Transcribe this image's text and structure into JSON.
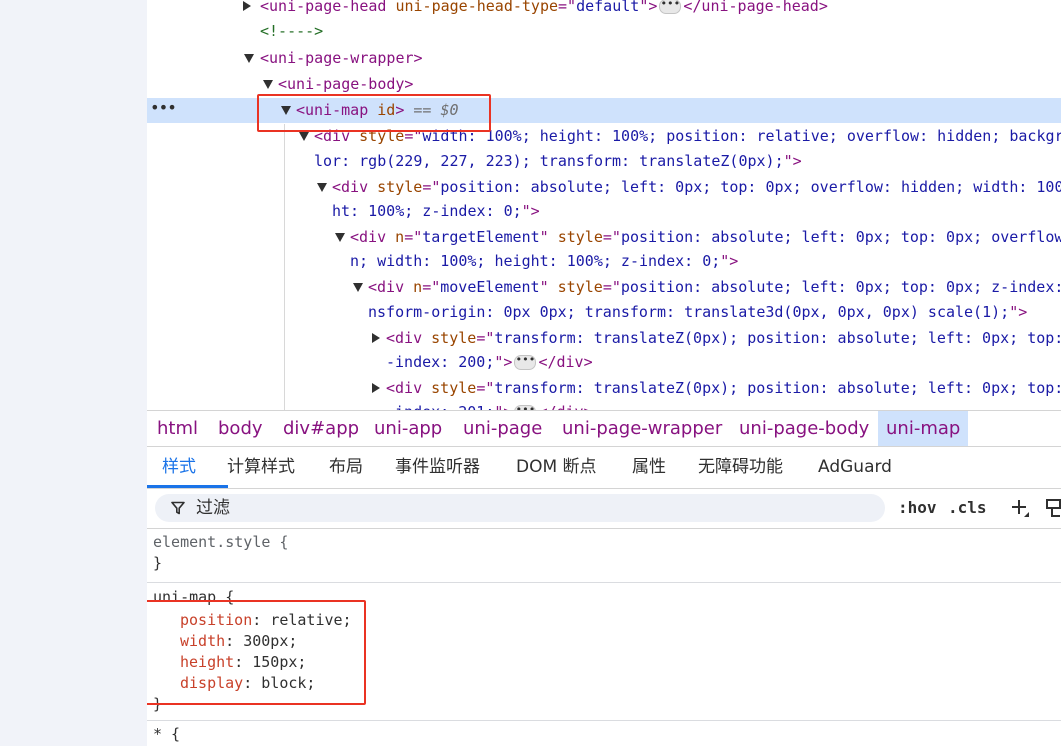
{
  "dom_tree": {
    "lines": [
      {
        "id": "head",
        "parts": [
          [
            "tag",
            "<uni-page-head "
          ],
          [
            "attr",
            "uni-page-head-type"
          ],
          [
            "tag",
            "=\""
          ],
          [
            "val",
            "default"
          ],
          [
            "tag",
            "\">"
          ],
          [
            "pill",
            ""
          ],
          [
            "tag",
            "</uni-page-head>"
          ]
        ]
      },
      {
        "id": "comment",
        "parts": [
          [
            "cmt",
            "<!---->"
          ]
        ]
      },
      {
        "id": "wrapper",
        "parts": [
          [
            "tag",
            "<uni-page-wrapper>"
          ]
        ]
      },
      {
        "id": "body",
        "parts": [
          [
            "tag",
            "<uni-page-body>"
          ]
        ]
      },
      {
        "id": "map",
        "parts": [
          [
            "tag",
            "<uni-map "
          ],
          [
            "attr",
            "id"
          ],
          [
            "tag",
            ">"
          ],
          [
            "hint",
            " == $0"
          ]
        ]
      },
      {
        "id": "div1a",
        "parts": [
          [
            "tag",
            "<div "
          ],
          [
            "attr",
            "style"
          ],
          [
            "tag",
            "=\""
          ],
          [
            "val",
            "width: 100%; height: 100%; position: relative; overflow: hidden; backgr"
          ]
        ]
      },
      {
        "id": "div1b",
        "parts": [
          [
            "val",
            "lor: rgb(229, 227, 223); transform: translateZ(0px);"
          ],
          [
            "tag",
            "\">"
          ]
        ]
      },
      {
        "id": "div2a",
        "parts": [
          [
            "tag",
            "<div "
          ],
          [
            "attr",
            "style"
          ],
          [
            "tag",
            "=\""
          ],
          [
            "val",
            "position: absolute; left: 0px; top: 0px; overflow: hidden; width: 100"
          ]
        ]
      },
      {
        "id": "div2b",
        "parts": [
          [
            "val",
            "ht: 100%; z-index: 0;"
          ],
          [
            "tag",
            "\">"
          ]
        ]
      },
      {
        "id": "div3a",
        "parts": [
          [
            "tag",
            "<div "
          ],
          [
            "attr",
            "n"
          ],
          [
            "tag",
            "=\""
          ],
          [
            "val",
            "targetElement"
          ],
          [
            "tag",
            "\" "
          ],
          [
            "attr",
            "style"
          ],
          [
            "tag",
            "=\""
          ],
          [
            "val",
            "position: absolute; left: 0px; top: 0px; overflow"
          ]
        ]
      },
      {
        "id": "div3b",
        "parts": [
          [
            "val",
            "n; width: 100%; height: 100%; z-index: 0;"
          ],
          [
            "tag",
            "\">"
          ]
        ]
      },
      {
        "id": "div4a",
        "parts": [
          [
            "tag",
            "<div "
          ],
          [
            "attr",
            "n"
          ],
          [
            "tag",
            "=\""
          ],
          [
            "val",
            "moveElement"
          ],
          [
            "tag",
            "\" "
          ],
          [
            "attr",
            "style"
          ],
          [
            "tag",
            "=\""
          ],
          [
            "val",
            "position: absolute; left: 0px; top: 0px; z-index:"
          ]
        ]
      },
      {
        "id": "div4b",
        "parts": [
          [
            "val",
            "nsform-origin: 0px 0px; transform: translate3d(0px, 0px, 0px) scale(1);"
          ],
          [
            "tag",
            "\">"
          ]
        ]
      },
      {
        "id": "div5a",
        "parts": [
          [
            "tag",
            "<div "
          ],
          [
            "attr",
            "style"
          ],
          [
            "tag",
            "=\""
          ],
          [
            "val",
            "transform: translateZ(0px); position: absolute; left: 0px; top:"
          ]
        ]
      },
      {
        "id": "div5b",
        "parts": [
          [
            "val",
            "-index: 200;"
          ],
          [
            "tag",
            "\">"
          ],
          [
            "pill",
            ""
          ],
          [
            "tag",
            "</div>"
          ]
        ]
      },
      {
        "id": "div6a",
        "parts": [
          [
            "tag",
            "<div "
          ],
          [
            "attr",
            "style"
          ],
          [
            "tag",
            "=\""
          ],
          [
            "val",
            "transform: translateZ(0px); position: absolute; left: 0px; top:"
          ]
        ]
      },
      {
        "id": "div6b",
        "parts": [
          [
            "val",
            "-index: 201;"
          ],
          [
            "tag",
            "\">"
          ],
          [
            "pill",
            ""
          ],
          [
            "tag",
            "</div>"
          ]
        ]
      }
    ]
  },
  "row_menu": "•••",
  "breadcrumb": [
    "html",
    "body",
    "div#app",
    "uni-app",
    "uni-page",
    "uni-page-wrapper",
    "uni-page-body",
    "uni-map"
  ],
  "tabs": [
    "样式",
    "计算样式",
    "布局",
    "事件监听器",
    "DOM 断点",
    "属性",
    "无障碍功能",
    "AdGuard"
  ],
  "filter": {
    "placeholder": "过滤",
    "hov": ":hov",
    "cls": ".cls"
  },
  "styles": {
    "element_style_open": "element.style {",
    "close_brace": "}",
    "rule_selector": "uni-map {",
    "declarations": [
      {
        "name": "position",
        "value": "relative;"
      },
      {
        "name": "width",
        "value": "300px;"
      },
      {
        "name": "height",
        "value": "150px;"
      },
      {
        "name": "display",
        "value": "block;"
      }
    ],
    "next_selector": "* {"
  },
  "colors": {
    "accent": "#1a73e8",
    "selection": "#cfe2fc",
    "annotation_red": "#ea3323",
    "tag": "#881280"
  }
}
